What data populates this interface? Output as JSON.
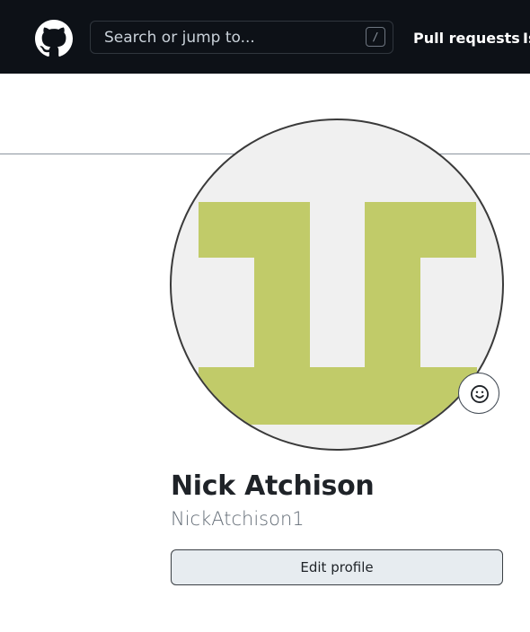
{
  "header": {
    "logo_icon": "github-mark-icon",
    "search": {
      "placeholder": "Search or jump to...",
      "shortcut": "/"
    },
    "nav": {
      "pull_requests": "Pull requests",
      "issues": "Issues"
    }
  },
  "profile": {
    "avatar": {
      "icon": "identicon-avatar",
      "color": "#c1cb69",
      "background": "#f0f0f0"
    },
    "status_icon": "smiley-icon",
    "name": "Nick Atchison",
    "username": "NickAtchison1",
    "edit_button": "Edit profile"
  }
}
